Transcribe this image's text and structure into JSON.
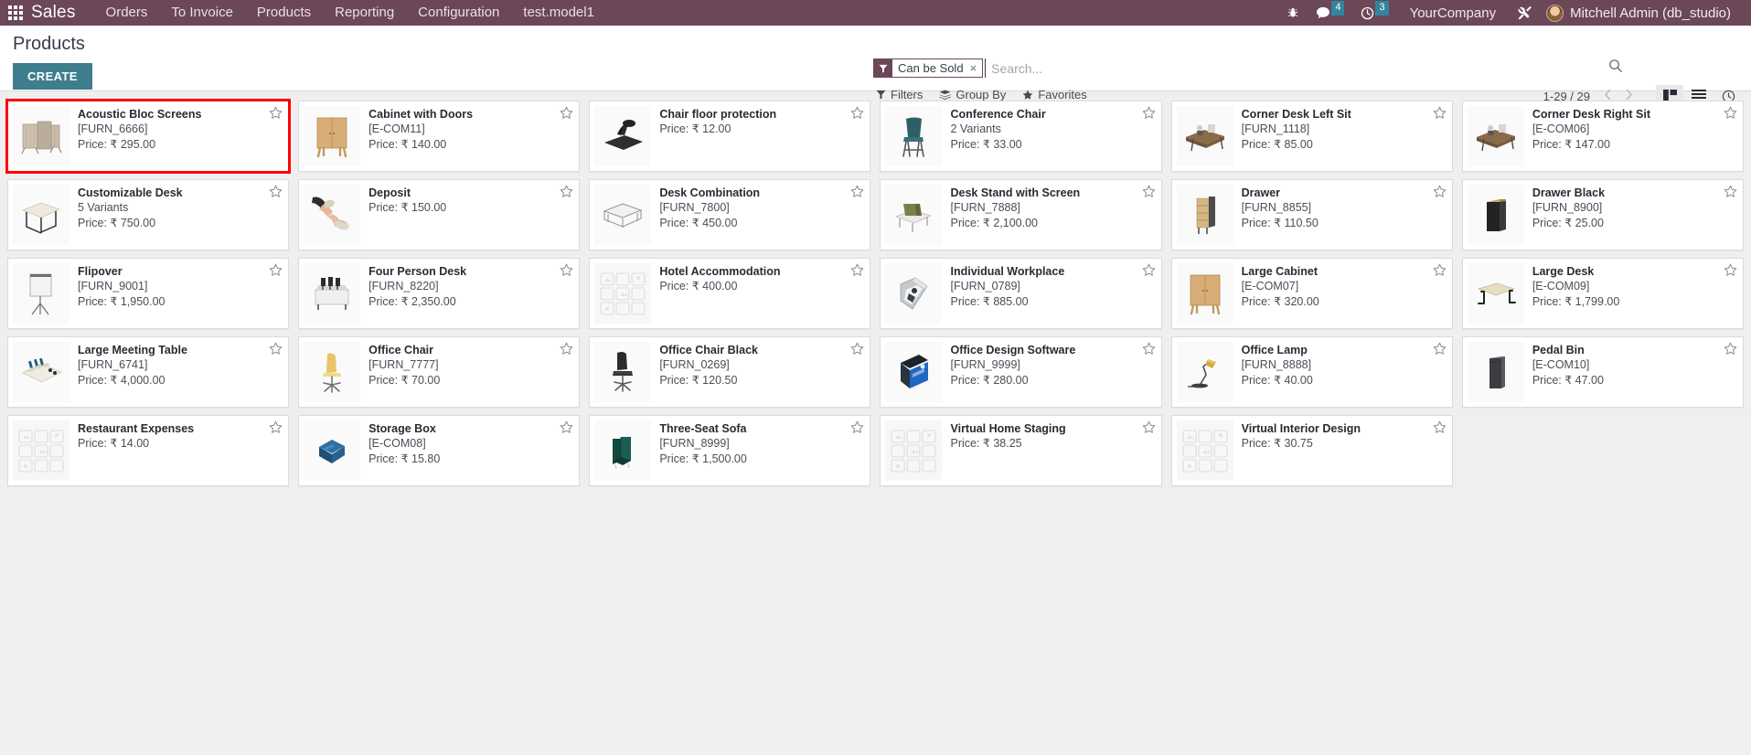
{
  "navbar": {
    "apps_icon": "apps-grid-icon",
    "brand": "Sales",
    "menus": [
      "Orders",
      "To Invoice",
      "Products",
      "Reporting",
      "Configuration",
      "test.model1"
    ],
    "bug_icon": "bug-icon",
    "messages_icon": "chat-bubble-icon",
    "messages_count": "4",
    "activities_icon": "clock-icon",
    "activities_count": "3",
    "company": "YourCompany",
    "tools_icon": "wrench-screwdriver-icon",
    "avatar_icon": "avatar",
    "user": "Mitchell Admin (db_studio)",
    "accent_color": "#6b4758",
    "badge_color": "#31859c"
  },
  "control_panel": {
    "title": "Products",
    "create_label": "CREATE",
    "create_color": "#3e7d8e",
    "search": {
      "facet_icon": "filter-funnel-icon",
      "facet_label": "Can be Sold",
      "facet_remove": "×",
      "placeholder": "Search...",
      "value": "",
      "magnifier_icon": "search-icon"
    },
    "menus": [
      {
        "label": "Filters",
        "icon": "filter-funnel-icon"
      },
      {
        "label": "Group By",
        "icon": "layers-icon"
      },
      {
        "label": "Favorites",
        "icon": "star-icon"
      }
    ],
    "pager": "1-29 / 29",
    "prev_icon": "chevron-left-icon",
    "next_icon": "chevron-right-icon",
    "views": [
      {
        "name": "kanban",
        "icon": "kanban-icon",
        "active": true
      },
      {
        "name": "list",
        "icon": "list-icon",
        "active": false
      },
      {
        "name": "activity",
        "icon": "clock-icon",
        "active": false
      }
    ]
  },
  "kanban": {
    "price_label": "Price:",
    "currency": "₹",
    "star_icon": "star-outline-icon",
    "cards": [
      {
        "name": "Acoustic Bloc Screens",
        "code": "[FURN_6666]",
        "price": "₹ 295.00",
        "img": "screens",
        "highlight": true
      },
      {
        "name": "Cabinet with Doors",
        "code": "[E-COM11]",
        "price": "₹ 140.00",
        "img": "cabinet",
        "highlight": false
      },
      {
        "name": "Chair floor protection",
        "code": "",
        "price": "₹ 12.00",
        "img": "floormat",
        "highlight": false
      },
      {
        "name": "Conference Chair",
        "code": "2 Variants",
        "price": "₹ 33.00",
        "img": "chair",
        "highlight": false
      },
      {
        "name": "Corner Desk Left Sit",
        "code": "[FURN_1118]",
        "price": "₹ 85.00",
        "img": "cornerdesk",
        "highlight": false
      },
      {
        "name": "Corner Desk Right Sit",
        "code": "[E-COM06]",
        "price": "₹ 147.00",
        "img": "cornerdesk",
        "highlight": false
      },
      {
        "name": "Customizable Desk",
        "code": "5 Variants",
        "price": "₹ 750.00",
        "img": "desk",
        "highlight": false
      },
      {
        "name": "Deposit",
        "code": "",
        "price": "₹ 150.00",
        "img": "money",
        "highlight": false
      },
      {
        "name": "Desk Combination",
        "code": "[FURN_7800]",
        "price": "₹ 450.00",
        "img": "deskcombo",
        "highlight": false
      },
      {
        "name": "Desk Stand with Screen",
        "code": "[FURN_7888]",
        "price": "₹ 2,100.00",
        "img": "deskstand",
        "highlight": false
      },
      {
        "name": "Drawer",
        "code": "[FURN_8855]",
        "price": "₹ 110.50",
        "img": "drawer",
        "highlight": false
      },
      {
        "name": "Drawer Black",
        "code": "[FURN_8900]",
        "price": "₹ 25.00",
        "img": "drawerblk",
        "highlight": false
      },
      {
        "name": "Flipover",
        "code": "[FURN_9001]",
        "price": "₹ 1,950.00",
        "img": "flipover",
        "highlight": false
      },
      {
        "name": "Four Person Desk",
        "code": "[FURN_8220]",
        "price": "₹ 2,350.00",
        "img": "fourdesk",
        "highlight": false
      },
      {
        "name": "Hotel Accommodation",
        "code": "",
        "price": "₹ 400.00",
        "img": "noimage",
        "highlight": false
      },
      {
        "name": "Individual Workplace",
        "code": "[FURN_0789]",
        "price": "₹ 885.00",
        "img": "pod",
        "highlight": false
      },
      {
        "name": "Large Cabinet",
        "code": "[E-COM07]",
        "price": "₹ 320.00",
        "img": "cabinet",
        "highlight": false
      },
      {
        "name": "Large Desk",
        "code": "[E-COM09]",
        "price": "₹ 1,799.00",
        "img": "largedesk",
        "highlight": false
      },
      {
        "name": "Large Meeting Table",
        "code": "[FURN_6741]",
        "price": "₹ 4,000.00",
        "img": "meeting",
        "highlight": false
      },
      {
        "name": "Office Chair",
        "code": "[FURN_7777]",
        "price": "₹ 70.00",
        "img": "chairy",
        "highlight": false
      },
      {
        "name": "Office Chair Black",
        "code": "[FURN_0269]",
        "price": "₹ 120.50",
        "img": "chairblk",
        "highlight": false
      },
      {
        "name": "Office Design Software",
        "code": "[FURN_9999]",
        "price": "₹ 280.00",
        "img": "software",
        "highlight": false
      },
      {
        "name": "Office Lamp",
        "code": "[FURN_8888]",
        "price": "₹ 40.00",
        "img": "lamp",
        "highlight": false
      },
      {
        "name": "Pedal Bin",
        "code": "[E-COM10]",
        "price": "₹ 47.00",
        "img": "bin",
        "highlight": false
      },
      {
        "name": "Restaurant Expenses",
        "code": "",
        "price": "₹ 14.00",
        "img": "noimage",
        "highlight": false
      },
      {
        "name": "Storage Box",
        "code": "[E-COM08]",
        "price": "₹ 15.80",
        "img": "box",
        "highlight": false
      },
      {
        "name": "Three-Seat Sofa",
        "code": "[FURN_8999]",
        "price": "₹ 1,500.00",
        "img": "sofa",
        "highlight": false
      },
      {
        "name": "Virtual Home Staging",
        "code": "",
        "price": "₹ 38.25",
        "img": "noimage",
        "highlight": false
      },
      {
        "name": "Virtual Interior Design",
        "code": "",
        "price": "₹ 30.75",
        "img": "noimage",
        "highlight": false
      }
    ]
  }
}
